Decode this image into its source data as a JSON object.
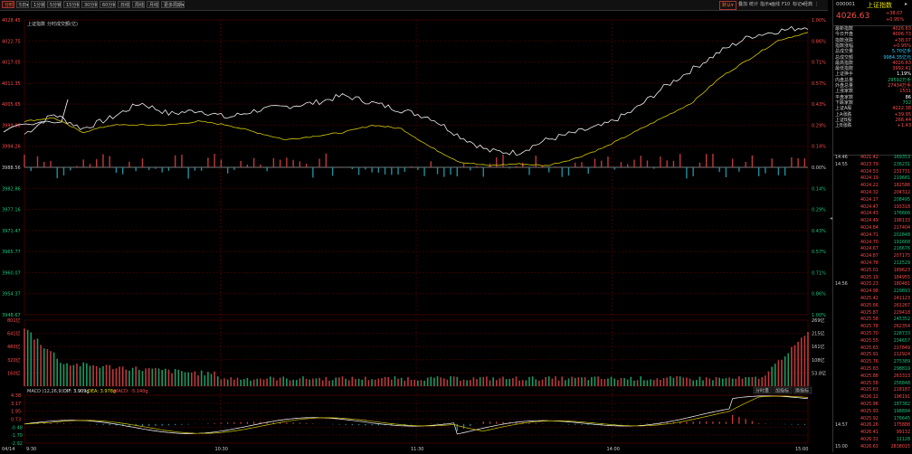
{
  "toolbar": {
    "tabs": [
      {
        "label": "分时",
        "active": true
      },
      {
        "label": "5日▾",
        "active": false
      },
      {
        "label": "1分钟",
        "active": false
      },
      {
        "label": "5分钟",
        "active": false
      },
      {
        "label": "15分钟",
        "active": false
      },
      {
        "label": "30分钟",
        "active": false
      },
      {
        "label": "60分钟",
        "active": false
      },
      {
        "label": "日线",
        "active": false
      },
      {
        "label": "周线",
        "active": false
      },
      {
        "label": "月线",
        "active": false
      },
      {
        "label": "更多周期▾",
        "active": false
      }
    ],
    "right_items": [
      {
        "label": "叠加",
        "active": false
      },
      {
        "label": "统计",
        "active": false
      },
      {
        "label": "指示▾",
        "active": false
      },
      {
        "label": "画线",
        "active": false
      },
      {
        "label": "F10",
        "active": false
      },
      {
        "label": "标记▾",
        "active": false
      },
      {
        "label": "经典",
        "active": false
      },
      {
        "label": "⋮",
        "active": false
      }
    ],
    "main_toggle": "默认▾"
  },
  "legend": {
    "index_name": "上证指数",
    "fenshi": "分时",
    "volume": "成交额(亿)"
  },
  "price_axis_left": [
    "4028.45",
    "4022.75",
    "4017.05",
    "4011.35",
    "4005.65",
    "3999.96",
    "3994.26",
    "3988.56",
    "3982.86",
    "3977.16",
    "3971.47",
    "3965.77",
    "3960.07",
    "3954.37",
    "3948.67"
  ],
  "price_axis_right": [
    "1.00%",
    "0.86%",
    "0.71%",
    "0.57%",
    "0.43%",
    "0.29%",
    "0.14%",
    "0.00%",
    "0.14%",
    "0.29%",
    "0.43%",
    "0.57%",
    "0.71%",
    "0.86%",
    "1.00%"
  ],
  "volume_axis_left": [
    "801亿",
    "641亿",
    "480亿",
    "320亿",
    "160亿"
  ],
  "volume_axis_right": [
    "269亿",
    "215亿",
    "161亿",
    "108亿",
    "53.8亿"
  ],
  "macd_legend": {
    "name": "MACD (12,26,9)",
    "dif": "DIF: 3.909g",
    "dea": "DEA: 3.978g",
    "macd": "MACD: -5.140g"
  },
  "macd_axis": [
    "4.38",
    "3.17",
    "1.95",
    "0.73",
    "-0.48",
    "-1.70",
    "-2.92"
  ],
  "macd_buttons": [
    "分时量",
    "加指标",
    "换指标"
  ],
  "time_axis": [
    "04/14",
    "9:30",
    "10:30",
    "11:30",
    "14:00",
    "15:00"
  ],
  "panel": {
    "code": "000001",
    "name": "上证指数",
    "price": "4026.63",
    "change": "+38.07",
    "change_pct": "+0.95%",
    "stats": [
      {
        "k": "最新指数",
        "v": "4026.63",
        "c": "up"
      },
      {
        "k": "今日开盘",
        "v": "4006.73",
        "c": "up"
      },
      {
        "k": "指数涨跌",
        "v": "+38.07",
        "c": "up"
      },
      {
        "k": "指数涨幅",
        "v": "+0.95%",
        "c": "up"
      },
      {
        "k": "总成交量",
        "v": "5.70亿手",
        "c": "cy"
      },
      {
        "k": "总成交额",
        "v": "9984.35亿元",
        "c": "cy"
      },
      {
        "k": "最高指数",
        "v": "4026.63",
        "c": "up"
      },
      {
        "k": "最低指数",
        "v": "3992.41",
        "c": "up"
      },
      {
        "k": "上证换手",
        "v": "1.19%",
        "c": "wh"
      },
      {
        "k": "内盘总量",
        "v": "29592万手",
        "c": "dn"
      },
      {
        "k": "外盘总量",
        "v": "27434万手",
        "c": "up"
      },
      {
        "k": "上涨家数",
        "v": "1531",
        "c": "up"
      },
      {
        "k": "平盘家数",
        "v": "86",
        "c": "wh"
      },
      {
        "k": "下跌家数",
        "v": "732",
        "c": "dn"
      },
      {
        "k": "上证A股",
        "v": "4222.38",
        "c": "up"
      },
      {
        "k": "上A涨跌",
        "v": "+39.95",
        "c": "up"
      },
      {
        "k": "上证B股",
        "v": "266.44",
        "c": "up"
      },
      {
        "k": "上B涨跌",
        "v": "+1.43",
        "c": "up"
      }
    ],
    "ticks": [
      {
        "t": "14:46",
        "p": "4021.42",
        "v": "169353",
        "c": "dn"
      },
      {
        "t": "14:55",
        "p": "4023.79",
        "v": "236231",
        "c": "dn"
      },
      {
        "t": "",
        "p": "4024.53",
        "v": "231731",
        "c": "up"
      },
      {
        "t": "",
        "p": "4024.19",
        "v": "219681",
        "c": "dn"
      },
      {
        "t": "",
        "p": "4024.22",
        "v": "182586",
        "c": "up"
      },
      {
        "t": "",
        "p": "4024.32",
        "v": "204312",
        "c": "up"
      },
      {
        "t": "",
        "p": "4024.17",
        "v": "208495",
        "c": "dn"
      },
      {
        "t": "",
        "p": "4024.47",
        "v": "193318",
        "c": "up"
      },
      {
        "t": "",
        "p": "4024.43",
        "v": "176666",
        "c": "dn"
      },
      {
        "t": "",
        "p": "4024.49",
        "v": "198133",
        "c": "up"
      },
      {
        "t": "",
        "p": "4024.84",
        "v": "217404",
        "c": "up"
      },
      {
        "t": "",
        "p": "4024.71",
        "v": "202848",
        "c": "dn"
      },
      {
        "t": "",
        "p": "4024.70",
        "v": "191668",
        "c": "dn"
      },
      {
        "t": "",
        "p": "4024.67",
        "v": "216676",
        "c": "dn"
      },
      {
        "t": "",
        "p": "4024.87",
        "v": "207175",
        "c": "up"
      },
      {
        "t": "",
        "p": "4024.78",
        "v": "212529",
        "c": "dn"
      },
      {
        "t": "",
        "p": "4025.01",
        "v": "189623",
        "c": "up"
      },
      {
        "t": "",
        "p": "4025.19",
        "v": "184955",
        "c": "up"
      },
      {
        "t": "14:56",
        "p": "4025.23",
        "v": "180481",
        "c": "up"
      },
      {
        "t": "",
        "p": "4024.98",
        "v": "229893",
        "c": "dn"
      },
      {
        "t": "",
        "p": "4025.42",
        "v": "241123",
        "c": "up"
      },
      {
        "t": "",
        "p": "4025.66",
        "v": "261267",
        "c": "up"
      },
      {
        "t": "",
        "p": "4025.87",
        "v": "229418",
        "c": "up"
      },
      {
        "t": "",
        "p": "4025.58",
        "v": "245352",
        "c": "dn"
      },
      {
        "t": "",
        "p": "4025.78",
        "v": "262354",
        "c": "up"
      },
      {
        "t": "",
        "p": "4025.70",
        "v": "228733",
        "c": "dn"
      },
      {
        "t": "",
        "p": "4025.55",
        "v": "234657",
        "c": "dn"
      },
      {
        "t": "",
        "p": "4025.63",
        "v": "217849",
        "c": "up"
      },
      {
        "t": "",
        "p": "4025.91",
        "v": "212924",
        "c": "up"
      },
      {
        "t": "",
        "p": "4025.76",
        "v": "275389",
        "c": "dn"
      },
      {
        "t": "",
        "p": "4025.63",
        "v": "298819",
        "c": "dn"
      },
      {
        "t": "",
        "p": "4025.88",
        "v": "263313",
        "c": "up"
      },
      {
        "t": "",
        "p": "4025.58",
        "v": "256848",
        "c": "dn"
      },
      {
        "t": "",
        "p": "4025.63",
        "v": "218187",
        "c": "up"
      },
      {
        "t": "",
        "p": "4026.12",
        "v": "196191",
        "c": "up"
      },
      {
        "t": "",
        "p": "4025.96",
        "v": "187382",
        "c": "dn"
      },
      {
        "t": "",
        "p": "4025.93",
        "v": "198894",
        "c": "dn"
      },
      {
        "t": "",
        "p": "4025.92",
        "v": "176645",
        "c": "dn"
      },
      {
        "t": "14:57",
        "p": "4026.26",
        "v": "175888",
        "c": "up"
      },
      {
        "t": "",
        "p": "4026.41",
        "v": "99132",
        "c": "up"
      },
      {
        "t": "",
        "p": "4026.31",
        "v": "11128",
        "c": "dn"
      },
      {
        "t": "15:00",
        "p": "4026.63",
        "v": "2838015",
        "c": "up"
      }
    ]
  },
  "chart_data": {
    "type": "line",
    "title": "上证指数 分时",
    "x": [
      "9:30",
      "10:30",
      "11:30/13:00",
      "14:00",
      "15:00"
    ],
    "prev_close": 3988.56,
    "ylim": [
      3948.67,
      4028.45
    ],
    "series": [
      {
        "name": "price",
        "values": [
          3997.5,
          4003,
          3999,
          4002,
          4006,
          4003,
          4004,
          4002,
          4004,
          4005,
          4006,
          4008,
          4006,
          4004,
          4002,
          3997,
          3993,
          3992.5,
          3996,
          3998,
          4000,
          4004,
          4010,
          4015,
          4020,
          4024,
          4025.5,
          4026.63
        ]
      },
      {
        "name": "avg",
        "values": [
          4001,
          4002,
          3998,
          4000,
          4000,
          4000,
          4001,
          4000,
          3998,
          3996,
          3997,
          3998,
          4000,
          3999,
          3994,
          3990,
          3989,
          3989.5,
          3989,
          3991,
          3994,
          3998,
          4002,
          4006,
          4013,
          4018,
          4023,
          4025
        ]
      }
    ],
    "volume_ylim": [
      0,
      801
    ],
    "macd_ylim": [
      -2.92,
      4.38
    ]
  }
}
